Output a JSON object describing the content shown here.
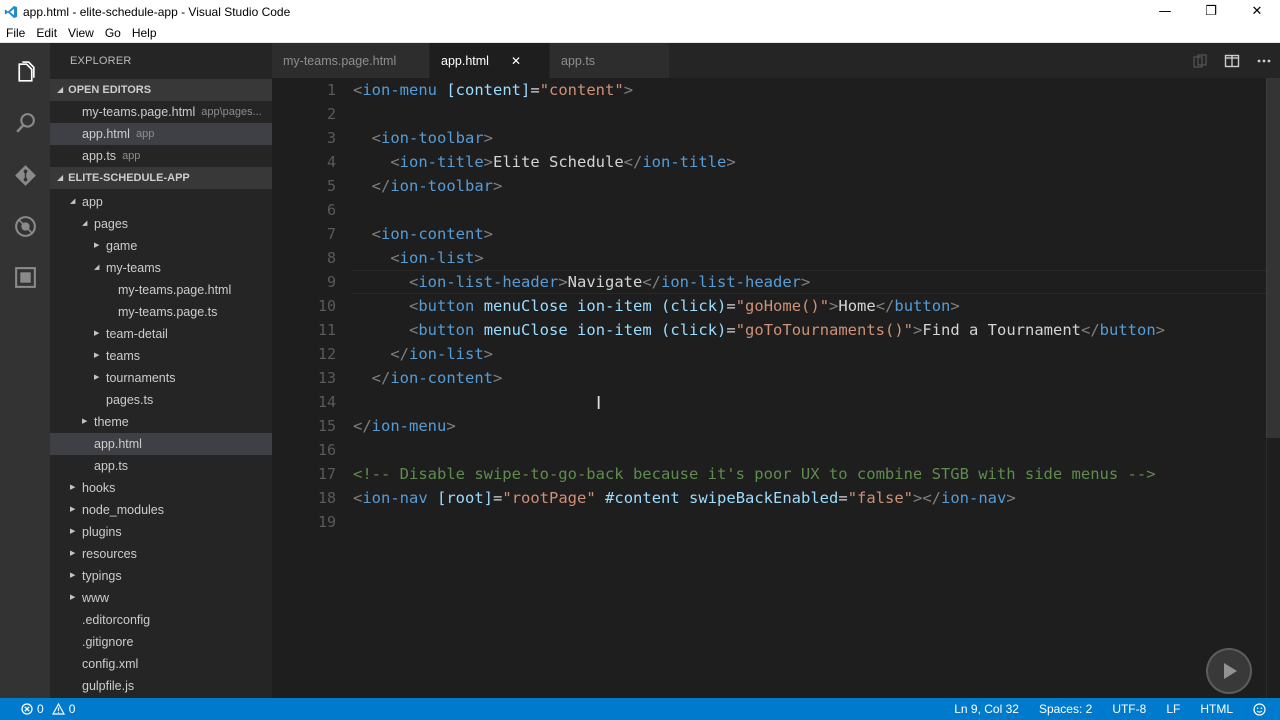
{
  "window": {
    "title": "app.html - elite-schedule-app - Visual Studio Code",
    "minimize": "—",
    "maximize": "❐",
    "close": "✕"
  },
  "menu": [
    "File",
    "Edit",
    "View",
    "Go",
    "Help"
  ],
  "sidebar": {
    "title": "EXPLORER",
    "open_editors_header": "OPEN EDITORS",
    "open_editors": [
      {
        "name": "my-teams.page.html",
        "desc": "app\\pages..."
      },
      {
        "name": "app.html",
        "desc": "app"
      },
      {
        "name": "app.ts",
        "desc": "app"
      }
    ],
    "project_header": "ELITE-SCHEDULE-APP",
    "tree": [
      {
        "name": "app",
        "twist": "open"
      },
      {
        "name": "pages",
        "twist": "open"
      },
      {
        "name": "game",
        "twist": "closed"
      },
      {
        "name": "my-teams",
        "twist": "open"
      },
      {
        "name": "my-teams.page.html",
        "twist": "none"
      },
      {
        "name": "my-teams.page.ts",
        "twist": "none"
      },
      {
        "name": "team-detail",
        "twist": "closed"
      },
      {
        "name": "teams",
        "twist": "closed"
      },
      {
        "name": "tournaments",
        "twist": "closed"
      },
      {
        "name": "pages.ts",
        "twist": "none"
      },
      {
        "name": "theme",
        "twist": "closed"
      },
      {
        "name": "app.html",
        "twist": "none"
      },
      {
        "name": "app.ts",
        "twist": "none"
      },
      {
        "name": "hooks",
        "twist": "closed"
      },
      {
        "name": "node_modules",
        "twist": "closed"
      },
      {
        "name": "plugins",
        "twist": "closed"
      },
      {
        "name": "resources",
        "twist": "closed"
      },
      {
        "name": "typings",
        "twist": "closed"
      },
      {
        "name": "www",
        "twist": "closed"
      },
      {
        "name": ".editorconfig",
        "twist": "none"
      },
      {
        "name": ".gitignore",
        "twist": "none"
      },
      {
        "name": "config.xml",
        "twist": "none"
      },
      {
        "name": "gulpfile.js",
        "twist": "none"
      }
    ]
  },
  "tabs": [
    {
      "label": "my-teams.page.html",
      "active": false
    },
    {
      "label": "app.html",
      "active": true,
      "close": "✕"
    },
    {
      "label": "app.ts",
      "active": false
    }
  ],
  "editor": {
    "line_numbers": [
      "1",
      "2",
      "3",
      "4",
      "5",
      "6",
      "7",
      "8",
      "9",
      "10",
      "11",
      "12",
      "13",
      "14",
      "15",
      "16",
      "17",
      "18",
      "19"
    ],
    "lines": [
      [
        [
          "br",
          "<"
        ],
        [
          "tag",
          "ion-menu"
        ],
        [
          "txt",
          " "
        ],
        [
          "attr",
          "[content]"
        ],
        [
          "txt",
          "="
        ],
        [
          "str",
          "\"content\""
        ],
        [
          "br",
          ">"
        ]
      ],
      [],
      [
        [
          "txt",
          "  "
        ],
        [
          "br",
          "<"
        ],
        [
          "tag",
          "ion-toolbar"
        ],
        [
          "br",
          ">"
        ]
      ],
      [
        [
          "txt",
          "    "
        ],
        [
          "br",
          "<"
        ],
        [
          "tag",
          "ion-title"
        ],
        [
          "br",
          ">"
        ],
        [
          "txt",
          "Elite Schedule"
        ],
        [
          "br",
          "</"
        ],
        [
          "tag",
          "ion-title"
        ],
        [
          "br",
          ">"
        ]
      ],
      [
        [
          "txt",
          "  "
        ],
        [
          "br",
          "</"
        ],
        [
          "tag",
          "ion-toolbar"
        ],
        [
          "br",
          ">"
        ]
      ],
      [],
      [
        [
          "txt",
          "  "
        ],
        [
          "br",
          "<"
        ],
        [
          "tag",
          "ion-content"
        ],
        [
          "br",
          ">"
        ]
      ],
      [
        [
          "txt",
          "    "
        ],
        [
          "br",
          "<"
        ],
        [
          "tag",
          "ion-list"
        ],
        [
          "br",
          ">"
        ]
      ],
      [
        [
          "txt",
          "      "
        ],
        [
          "br",
          "<"
        ],
        [
          "tag",
          "ion-list-header"
        ],
        [
          "br",
          ">"
        ],
        [
          "txt",
          "Navigate"
        ],
        [
          "br",
          "</"
        ],
        [
          "tag",
          "ion-list-header"
        ],
        [
          "br",
          ">"
        ]
      ],
      [
        [
          "txt",
          "      "
        ],
        [
          "br",
          "<"
        ],
        [
          "tag",
          "button"
        ],
        [
          "txt",
          " "
        ],
        [
          "attr",
          "menuClose"
        ],
        [
          "txt",
          " "
        ],
        [
          "attr",
          "ion-item"
        ],
        [
          "txt",
          " "
        ],
        [
          "attr",
          "(click)"
        ],
        [
          "txt",
          "="
        ],
        [
          "str",
          "\"goHome()\""
        ],
        [
          "br",
          ">"
        ],
        [
          "txt",
          "Home"
        ],
        [
          "br",
          "</"
        ],
        [
          "tag",
          "button"
        ],
        [
          "br",
          ">"
        ]
      ],
      [
        [
          "txt",
          "      "
        ],
        [
          "br",
          "<"
        ],
        [
          "tag",
          "button"
        ],
        [
          "txt",
          " "
        ],
        [
          "attr",
          "menuClose"
        ],
        [
          "txt",
          " "
        ],
        [
          "attr",
          "ion-item"
        ],
        [
          "txt",
          " "
        ],
        [
          "attr",
          "(click)"
        ],
        [
          "txt",
          "="
        ],
        [
          "str",
          "\"goToTournaments()\""
        ],
        [
          "br",
          ">"
        ],
        [
          "txt",
          "Find a Tournament"
        ],
        [
          "br",
          "</"
        ],
        [
          "tag",
          "button"
        ],
        [
          "br",
          ">"
        ]
      ],
      [
        [
          "txt",
          "    "
        ],
        [
          "br",
          "</"
        ],
        [
          "tag",
          "ion-list"
        ],
        [
          "br",
          ">"
        ]
      ],
      [
        [
          "txt",
          "  "
        ],
        [
          "br",
          "</"
        ],
        [
          "tag",
          "ion-content"
        ],
        [
          "br",
          ">"
        ]
      ],
      [],
      [
        [
          "br",
          "</"
        ],
        [
          "tag",
          "ion-menu"
        ],
        [
          "br",
          ">"
        ]
      ],
      [],
      [
        [
          "cmt",
          "<!-- Disable swipe-to-go-back because it's poor UX to combine STGB with side menus -->"
        ]
      ],
      [
        [
          "br",
          "<"
        ],
        [
          "tag",
          "ion-nav"
        ],
        [
          "txt",
          " "
        ],
        [
          "attr",
          "[root]"
        ],
        [
          "txt",
          "="
        ],
        [
          "str",
          "\"rootPage\""
        ],
        [
          "txt",
          " "
        ],
        [
          "attr",
          "#content"
        ],
        [
          "txt",
          " "
        ],
        [
          "attr",
          "swipeBackEnabled"
        ],
        [
          "txt",
          "="
        ],
        [
          "str",
          "\"false\""
        ],
        [
          "br",
          "></"
        ],
        [
          "tag",
          "ion-nav"
        ],
        [
          "br",
          ">"
        ]
      ],
      []
    ]
  },
  "statusbar": {
    "errors": "0",
    "warnings": "0",
    "position": "Ln 9, Col 32",
    "spaces": "Spaces: 2",
    "encoding": "UTF-8",
    "eol": "LF",
    "language": "HTML"
  },
  "colors": {
    "accent": "#007acc",
    "tag": "#569cd6",
    "attr": "#9cdcfe",
    "string": "#ce9178",
    "comment": "#608b4e"
  }
}
